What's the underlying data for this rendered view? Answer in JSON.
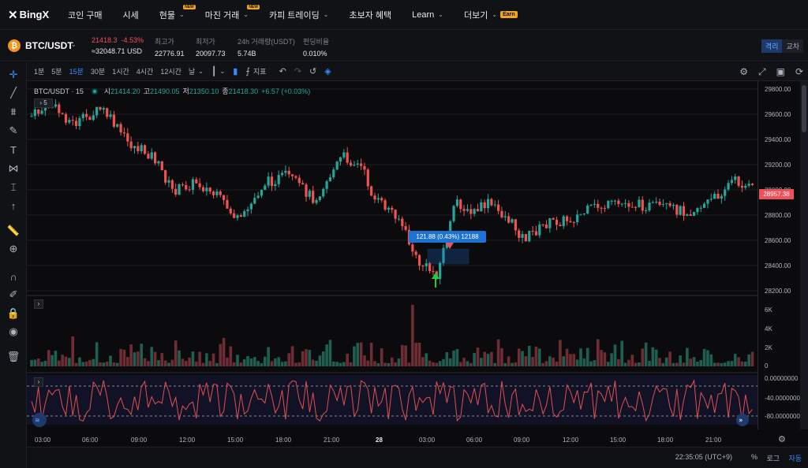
{
  "nav": {
    "logo": "BingX",
    "items": [
      {
        "label": "코인 구매",
        "chev": "",
        "badge": ""
      },
      {
        "label": "시세",
        "chev": "",
        "badge": ""
      },
      {
        "label": "현물",
        "chev": "⌄",
        "badge": "NEW"
      },
      {
        "label": "마진 거래",
        "chev": "⌄",
        "badge": "NEW"
      },
      {
        "label": "카피 트레이딩",
        "chev": "⌄",
        "badge": ""
      },
      {
        "label": "초보자 혜택",
        "chev": "",
        "badge": ""
      },
      {
        "label": "Learn",
        "chev": "⌄",
        "badge": ""
      },
      {
        "label": "더보기",
        "chev": "⌄",
        "badge": ""
      }
    ],
    "earn": "Earn"
  },
  "ticker": {
    "pair": "BTC/USDT",
    "last": "21418.3",
    "change": "-4.53%",
    "usd": "≈32048.71 USD",
    "high_label": "최고가",
    "high": "22776.91",
    "low_label": "최저가",
    "low": "20097.73",
    "vol_label": "24h 거래량(USDT)",
    "vol": "5.74B",
    "fund_label": "펀딩비율",
    "fund": "0.010%",
    "toggle": [
      "격리",
      "교차"
    ]
  },
  "toolbar": {
    "timeframes": [
      "1분",
      "5분",
      "15분",
      "30분",
      "1시간",
      "4시간",
      "12시간",
      "날"
    ],
    "active": "15분",
    "indicator_label": "지표"
  },
  "legend": {
    "symbol": "BTC/USDT · 15",
    "o_label": "시",
    "o": "21414.20",
    "h_label": "고",
    "h": "21490.05",
    "l_label": "저",
    "l": "21350.10",
    "c_label": "종",
    "c": "21418.30",
    "chg": "+6.57 (+0.03%)",
    "collapse": "5"
  },
  "price_axis": [
    "29800.00",
    "29600.00",
    "29400.00",
    "29200.00",
    "29000.00",
    "28800.00",
    "28600.00",
    "28400.00",
    "28200.00"
  ],
  "current_price": "28957.38",
  "volume_axis": [
    "6K",
    "4K",
    "2K",
    "0"
  ],
  "osc_axis": [
    "0.00000000",
    "-40.00000000",
    "-80.00000000"
  ],
  "measure_label": "121.88 (0.43%) 12188",
  "time_axis": [
    "03:00",
    "06:00",
    "09:00",
    "12:00",
    "15:00",
    "18:00",
    "21:00",
    "28",
    "03:00",
    "06:00",
    "09:00",
    "12:00",
    "15:00",
    "18:00",
    "21:00"
  ],
  "footer": {
    "clock": "22:35:05 (UTC+9)",
    "percent": "%",
    "log": "로그",
    "auto": "자동"
  },
  "colors": {
    "up": "#26a69a",
    "down": "#ef5350",
    "accent": "#3b8bff",
    "brand": "#f0a623"
  }
}
